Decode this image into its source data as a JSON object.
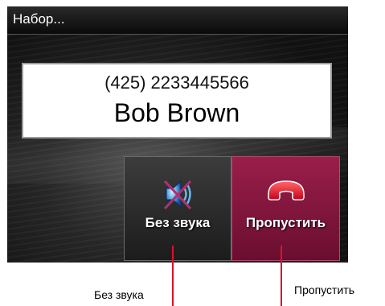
{
  "window": {
    "title": "Набор..."
  },
  "call": {
    "number": "(425) 2233445566",
    "name": "Bob Brown"
  },
  "buttons": {
    "mute": {
      "label": "Без звука",
      "icon": "muted-speaker-icon"
    },
    "skip": {
      "label": "Пропустить",
      "icon": "hang-up-phone-icon"
    }
  },
  "callouts": {
    "mute_label": "Без звука",
    "skip_label": "Пропустить"
  },
  "colors": {
    "skip_button": "#8a1a40",
    "hang_up_icon": "#e0102a",
    "callout": "#e0102a"
  }
}
